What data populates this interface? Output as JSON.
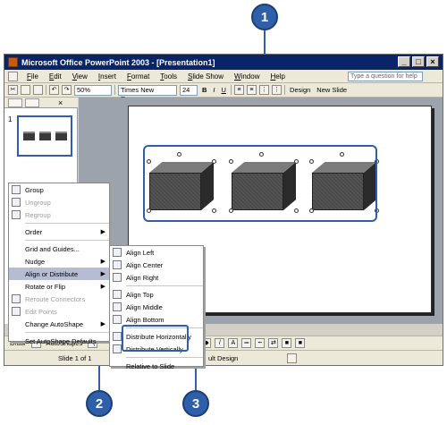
{
  "callouts": [
    "1",
    "2",
    "3"
  ],
  "window": {
    "title": "Microsoft Office PowerPoint 2003 - [Presentation1]",
    "caption_buttons": [
      "_",
      "□",
      "×"
    ]
  },
  "menubar": {
    "items": [
      "File",
      "Edit",
      "View",
      "Insert",
      "Format",
      "Tools",
      "Slide Show",
      "Window",
      "Help"
    ],
    "help_placeholder": "Type a question for help"
  },
  "toolbar": {
    "zoom": "50%",
    "font": "Times New Roman",
    "size": "24",
    "bold": "B",
    "italic": "I",
    "underline": "U",
    "design_label": "Design",
    "new_slide_label": "New Slide"
  },
  "outline": {
    "slide_number": "1",
    "close": "×"
  },
  "drawbar": {
    "draw_label": "Draw",
    "autoshapes_label": "AutoShapes"
  },
  "statusbar": {
    "slide_info": "Slide 1 of 1",
    "design": "ult Design"
  },
  "draw_menu": {
    "group": "Group",
    "ungroup": "Ungroup",
    "regroup": "Regroup",
    "order": "Order",
    "grid_guides": "Grid and Guides...",
    "nudge": "Nudge",
    "align_distribute": "Align or Distribute",
    "rotate_flip": "Rotate or Flip",
    "reroute": "Reroute Connectors",
    "edit_points": "Edit Points",
    "change_autoshape": "Change AutoShape",
    "set_defaults": "Set AutoShape Defaults"
  },
  "align_menu": {
    "align_left": "Align Left",
    "align_center": "Align Center",
    "align_right": "Align Right",
    "align_top": "Align Top",
    "align_middle": "Align Middle",
    "align_bottom": "Align Bottom",
    "distribute_h": "Distribute Horizontally",
    "distribute_v": "Distribute Vertically",
    "relative_slide": "Relative to Slide"
  },
  "colors": {
    "callout": "#2f5fa8",
    "titlebar": "#0a246a",
    "slide_bg": "#9da3ad"
  }
}
